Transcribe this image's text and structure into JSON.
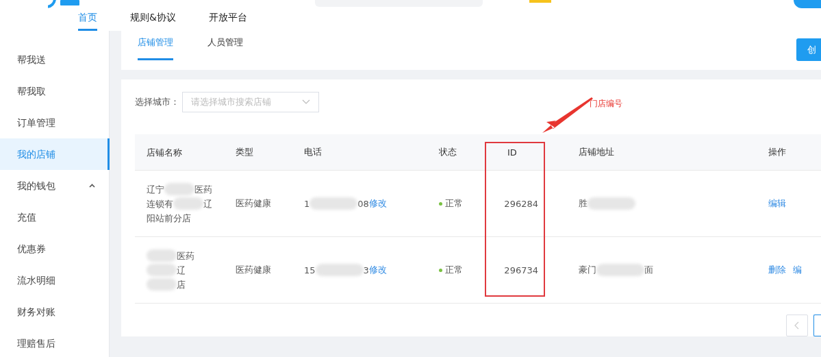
{
  "top_nav": [
    {
      "label": "首页",
      "selected": true
    },
    {
      "label": "规则&协议",
      "selected": false
    },
    {
      "label": "开放平台",
      "selected": false
    }
  ],
  "sidebar": {
    "items": [
      {
        "label": "帮我送",
        "selected": false
      },
      {
        "label": "帮我取",
        "selected": false
      },
      {
        "label": "订单管理",
        "selected": false
      },
      {
        "label": "我的店铺",
        "selected": true
      },
      {
        "label": "我的钱包",
        "selected": false,
        "expanded": true,
        "children": [
          {
            "label": "充值",
            "selected": false
          },
          {
            "label": "优惠券",
            "selected": false
          },
          {
            "label": "流水明细",
            "selected": false
          },
          {
            "label": "财务对账",
            "selected": false
          },
          {
            "label": "理赔售后",
            "selected": false
          }
        ]
      }
    ]
  },
  "tabs": [
    {
      "label": "店铺管理",
      "selected": true
    },
    {
      "label": "人员管理",
      "selected": false
    }
  ],
  "create_button": "创",
  "filter": {
    "label": "选择城市：",
    "placeholder": "请选择城市搜索店铺"
  },
  "annotation": "门店编号",
  "table": {
    "columns": [
      "店铺名称",
      "类型",
      "电话",
      "状态",
      "ID",
      "店铺地址",
      "操作"
    ],
    "rows": [
      {
        "name": [
          [
            {
              "text": "辽宁"
            },
            {
              "kind": "blur"
            },
            {
              "text": "医药"
            }
          ],
          [
            {
              "text": "连锁有"
            },
            {
              "kind": "blur"
            },
            {
              "text": "辽"
            }
          ],
          [
            {
              "text": "阳站前分店"
            }
          ]
        ],
        "type": "医药健康",
        "phone": [
          {
            "text": "1"
          },
          {
            "kind": "blur"
          },
          {
            "text": "08"
          }
        ],
        "phone_link": "修改",
        "status": {
          "label": "正常",
          "color": "#7ac143"
        },
        "id": "296284",
        "address": [
          {
            "text": "胜"
          },
          {
            "kind": "blur"
          }
        ],
        "actions": [
          "编辑"
        ]
      },
      {
        "name": [
          [
            {
              "kind": "blur"
            },
            {
              "text": "医药"
            }
          ],
          [
            {
              "kind": "blur"
            },
            {
              "text": "辽"
            }
          ],
          [
            {
              "kind": "blur"
            },
            {
              "text": "店"
            }
          ]
        ],
        "type": "医药健康",
        "phone": [
          {
            "text": "15"
          },
          {
            "kind": "blur"
          },
          {
            "text": "3"
          }
        ],
        "phone_link": "修改",
        "status": {
          "label": "正常",
          "color": "#7ac143"
        },
        "id": "296734",
        "address": [
          {
            "text": "豪门"
          },
          {
            "kind": "blur"
          },
          {
            "text": "面"
          }
        ],
        "actions": [
          "删除",
          "编"
        ]
      }
    ]
  }
}
